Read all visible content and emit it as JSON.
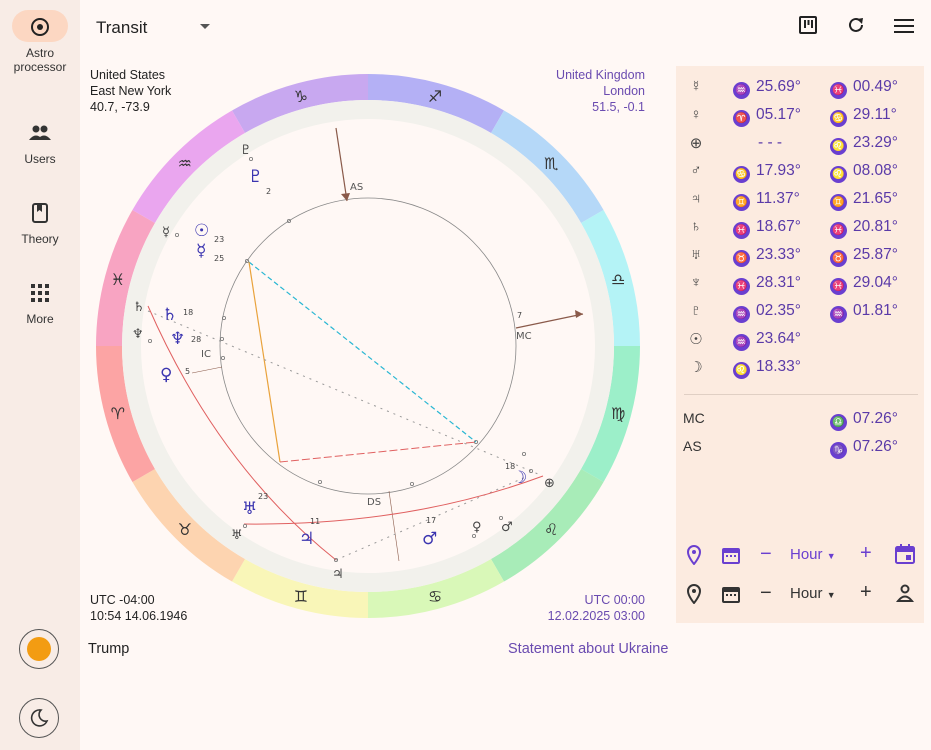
{
  "app": {
    "name_line1": "Astro",
    "name_line2": "processor"
  },
  "nav": [
    {
      "label": "Users",
      "icon": "users-icon"
    },
    {
      "label": "Theory",
      "icon": "book-icon"
    },
    {
      "label": "More",
      "icon": "grid-icon"
    }
  ],
  "toolbar": {
    "mode_value": "Transit"
  },
  "chart_left": {
    "country": "United States",
    "city": "East New York",
    "coords": "40.7, -73.9",
    "utc": "UTC -04:00",
    "datetime": "10:54 14.06.1946",
    "name": "Trump"
  },
  "chart_right": {
    "country": "United Kingdom",
    "city": "London",
    "coords": "51.5, -0.1",
    "utc": "UTC 00:00",
    "datetime": "12.02.2025 03:00",
    "name": "Statement about Ukraine"
  },
  "wheel": {
    "signs": [
      "♑",
      "♐",
      "♏",
      "♎",
      "♍",
      "♌",
      "♋",
      "♊",
      "♉",
      "♈",
      "♓",
      "♒"
    ],
    "angle_labels": {
      "as": "AS",
      "mc": "MC",
      "ic": "IC",
      "ds": "DS"
    },
    "small_numbers": [
      "2",
      "23",
      "25",
      "18",
      "28",
      "5",
      "7",
      "23",
      "11",
      "17",
      "18"
    ]
  },
  "planets": [
    {
      "glyph": "☿",
      "s1": "♒",
      "d1": "25.69°",
      "s2": "♓",
      "d2": "00.49°"
    },
    {
      "glyph": "♀",
      "s1": "♈",
      "d1": "05.17°",
      "s2": "♋",
      "d2": "29.11°"
    },
    {
      "glyph": "⊕",
      "s1": "",
      "d1": "- - -",
      "s2": "♌",
      "d2": "23.29°"
    },
    {
      "glyph": "♂",
      "s1": "♋",
      "d1": "17.93°",
      "s2": "♌",
      "d2": "08.08°"
    },
    {
      "glyph": "♃",
      "s1": "♊",
      "d1": "11.37°",
      "s2": "♊",
      "d2": "21.65°"
    },
    {
      "glyph": "♄",
      "s1": "♓",
      "d1": "18.67°",
      "s2": "♓",
      "d2": "20.81°"
    },
    {
      "glyph": "♅",
      "s1": "♉",
      "d1": "23.33°",
      "s2": "♉",
      "d2": "25.87°"
    },
    {
      "glyph": "♆",
      "s1": "♓",
      "d1": "28.31°",
      "s2": "♓",
      "d2": "29.04°"
    },
    {
      "glyph": "♇",
      "s1": "♒",
      "d1": "02.35°",
      "s2": "♒",
      "d2": "01.81°"
    },
    {
      "glyph": "☉",
      "s1": "♒",
      "d1": "23.64°",
      "s2": "",
      "d2": ""
    },
    {
      "glyph": "☽",
      "s1": "♌",
      "d1": "18.33°",
      "s2": "",
      "d2": ""
    }
  ],
  "angles": [
    {
      "label": "MC",
      "sign": "♎",
      "deg": "07.26°"
    },
    {
      "label": "AS",
      "sign": "♑",
      "deg": "07.26°"
    }
  ],
  "step_controls": [
    {
      "unit": "Hour"
    },
    {
      "unit": "Hour"
    }
  ],
  "colors": {
    "accent": "#6a3fd0",
    "orange_dot": "#f39c12"
  }
}
